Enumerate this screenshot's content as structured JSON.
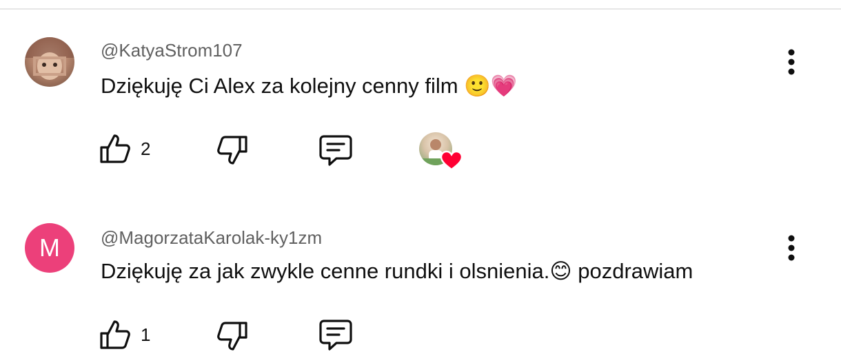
{
  "comments": [
    {
      "username": "@KatyaStrom107",
      "text": "Dziękuję Ci Alex za kolejny cenny film 🙂💗",
      "likes": "2",
      "avatar": "profile-photo",
      "creator_heart": true
    },
    {
      "username": "@MagorzataKarolak-ky1zm",
      "text": "Dziękuję za jak zwykle cenne rundki i olsnienia.😊 pozdrawiam",
      "likes": "1",
      "avatar_letter": "M",
      "avatar_color": "#ec407a",
      "creator_heart": false
    }
  ],
  "icons": {
    "like": "thumbs-up-icon",
    "dislike": "thumbs-down-icon",
    "reply": "reply-comment-icon",
    "menu": "more-vertical-icon",
    "heart": "heart-icon"
  },
  "colors": {
    "username": "#606060",
    "text": "#0f0f0f",
    "heart": "#ff0033"
  }
}
